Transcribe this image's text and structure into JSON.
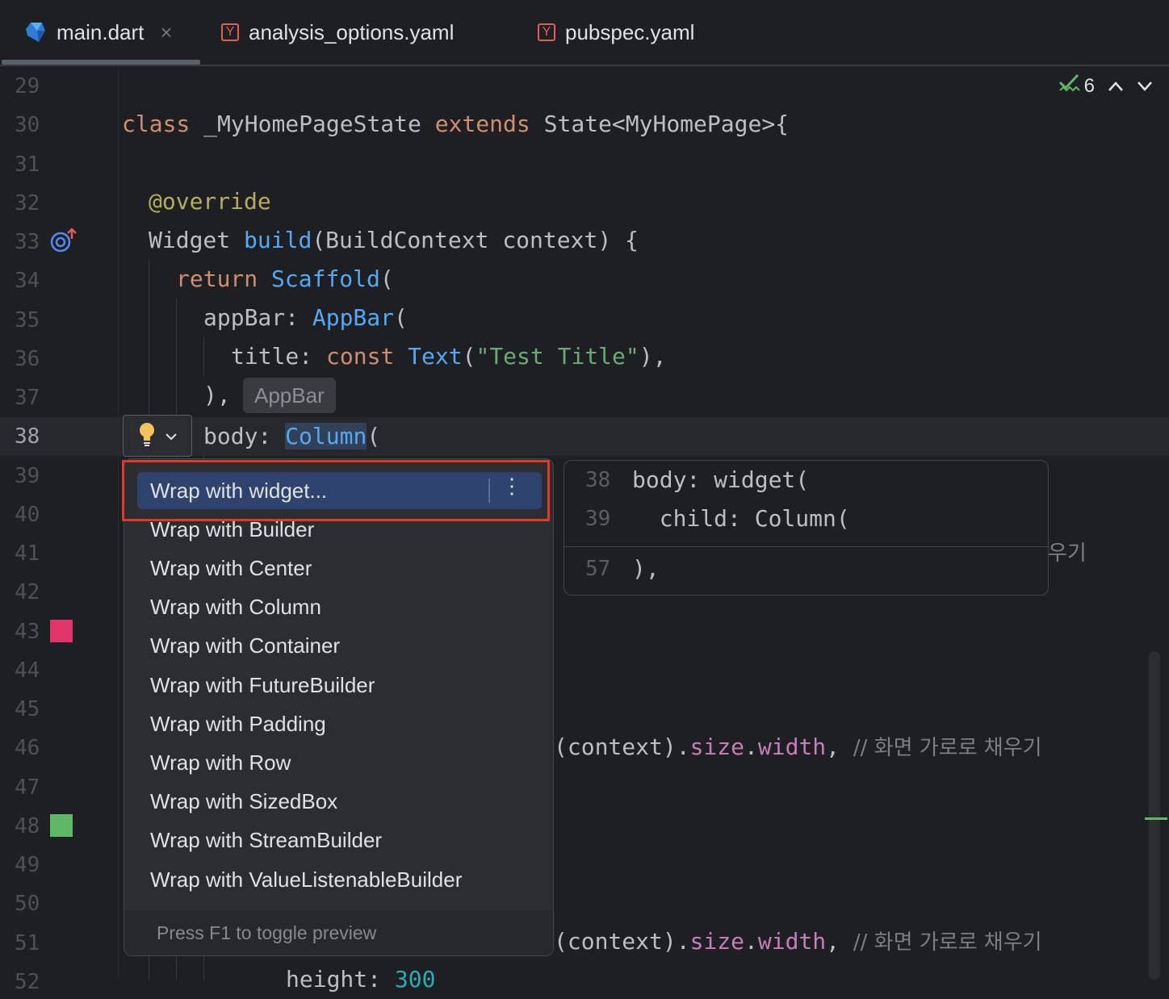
{
  "tabs": [
    {
      "label": "main.dart",
      "close": "×",
      "icon": "dart-icon"
    },
    {
      "label": "analysis_options.yaml",
      "icon": "yaml-icon",
      "icon_letter": "Y"
    },
    {
      "label": "pubspec.yaml",
      "icon": "yaml-icon",
      "icon_letter": "Y"
    }
  ],
  "status": {
    "count": "6"
  },
  "line_numbers": [
    "29",
    "30",
    "31",
    "32",
    "33",
    "34",
    "35",
    "36",
    "37",
    "38",
    "39",
    "40",
    "41",
    "42",
    "43",
    "44",
    "45",
    "46",
    "47",
    "48",
    "49",
    "50",
    "51",
    "52"
  ],
  "code": {
    "l30": {
      "kw1": "class",
      "t1": " _MyHomePageState ",
      "kw2": "extends",
      "t2": " State<MyHomePage>{"
    },
    "l32": {
      "ann": "@override"
    },
    "l33": {
      "t1": "Widget ",
      "fn": "build",
      "t2": "(BuildContext context) {"
    },
    "l34": {
      "kw": "return",
      "t1": " ",
      "fn": "Scaffold",
      "t2": "("
    },
    "l35": {
      "t1": "appBar: ",
      "fn": "AppBar",
      "t2": "("
    },
    "l36": {
      "t1": "title: ",
      "kw": "const",
      "t2": " ",
      "fn": "Text",
      "t3": "(",
      "str": "\"Test Title\"",
      "t4": "),"
    },
    "l37": {
      "t1": "),"
    },
    "l37_hint": "AppBar",
    "l38": {
      "t1": "body: ",
      "fn": "Column",
      "t2": "("
    },
    "l41_tail": "우기",
    "l46": {
      "t1": "(context).",
      "p1": "size",
      "t2": ".",
      "p2": "width",
      "t3": ", ",
      "cmt": "// 화면 가로로 채우기"
    },
    "l51": {
      "t1": "(context).",
      "p1": "size",
      "t2": ".",
      "p2": "width",
      "t3": ", ",
      "cmt": "// 화면 가로로 채우기"
    },
    "l52": {
      "t1": "height: ",
      "num": "300"
    }
  },
  "menu": {
    "items": [
      "Wrap with widget...",
      "Wrap with Builder",
      "Wrap with Center",
      "Wrap with Column",
      "Wrap with Container",
      "Wrap with FutureBuilder",
      "Wrap with Padding",
      "Wrap with Row",
      "Wrap with SizedBox",
      "Wrap with StreamBuilder",
      "Wrap with ValueListenableBuilder"
    ],
    "more": "⋮",
    "footer": "Press F1 to toggle preview"
  },
  "preview": {
    "rows": [
      {
        "no": "38",
        "code": "body: widget("
      },
      {
        "no": "39",
        "code": "  child: Column("
      },
      {
        "no": "57",
        "code": "),"
      }
    ]
  },
  "colors": {
    "accent": "#2e436e",
    "highlight_box": "#e0382d",
    "marker_red": "#e0356a",
    "marker_green": "#5fb865"
  }
}
